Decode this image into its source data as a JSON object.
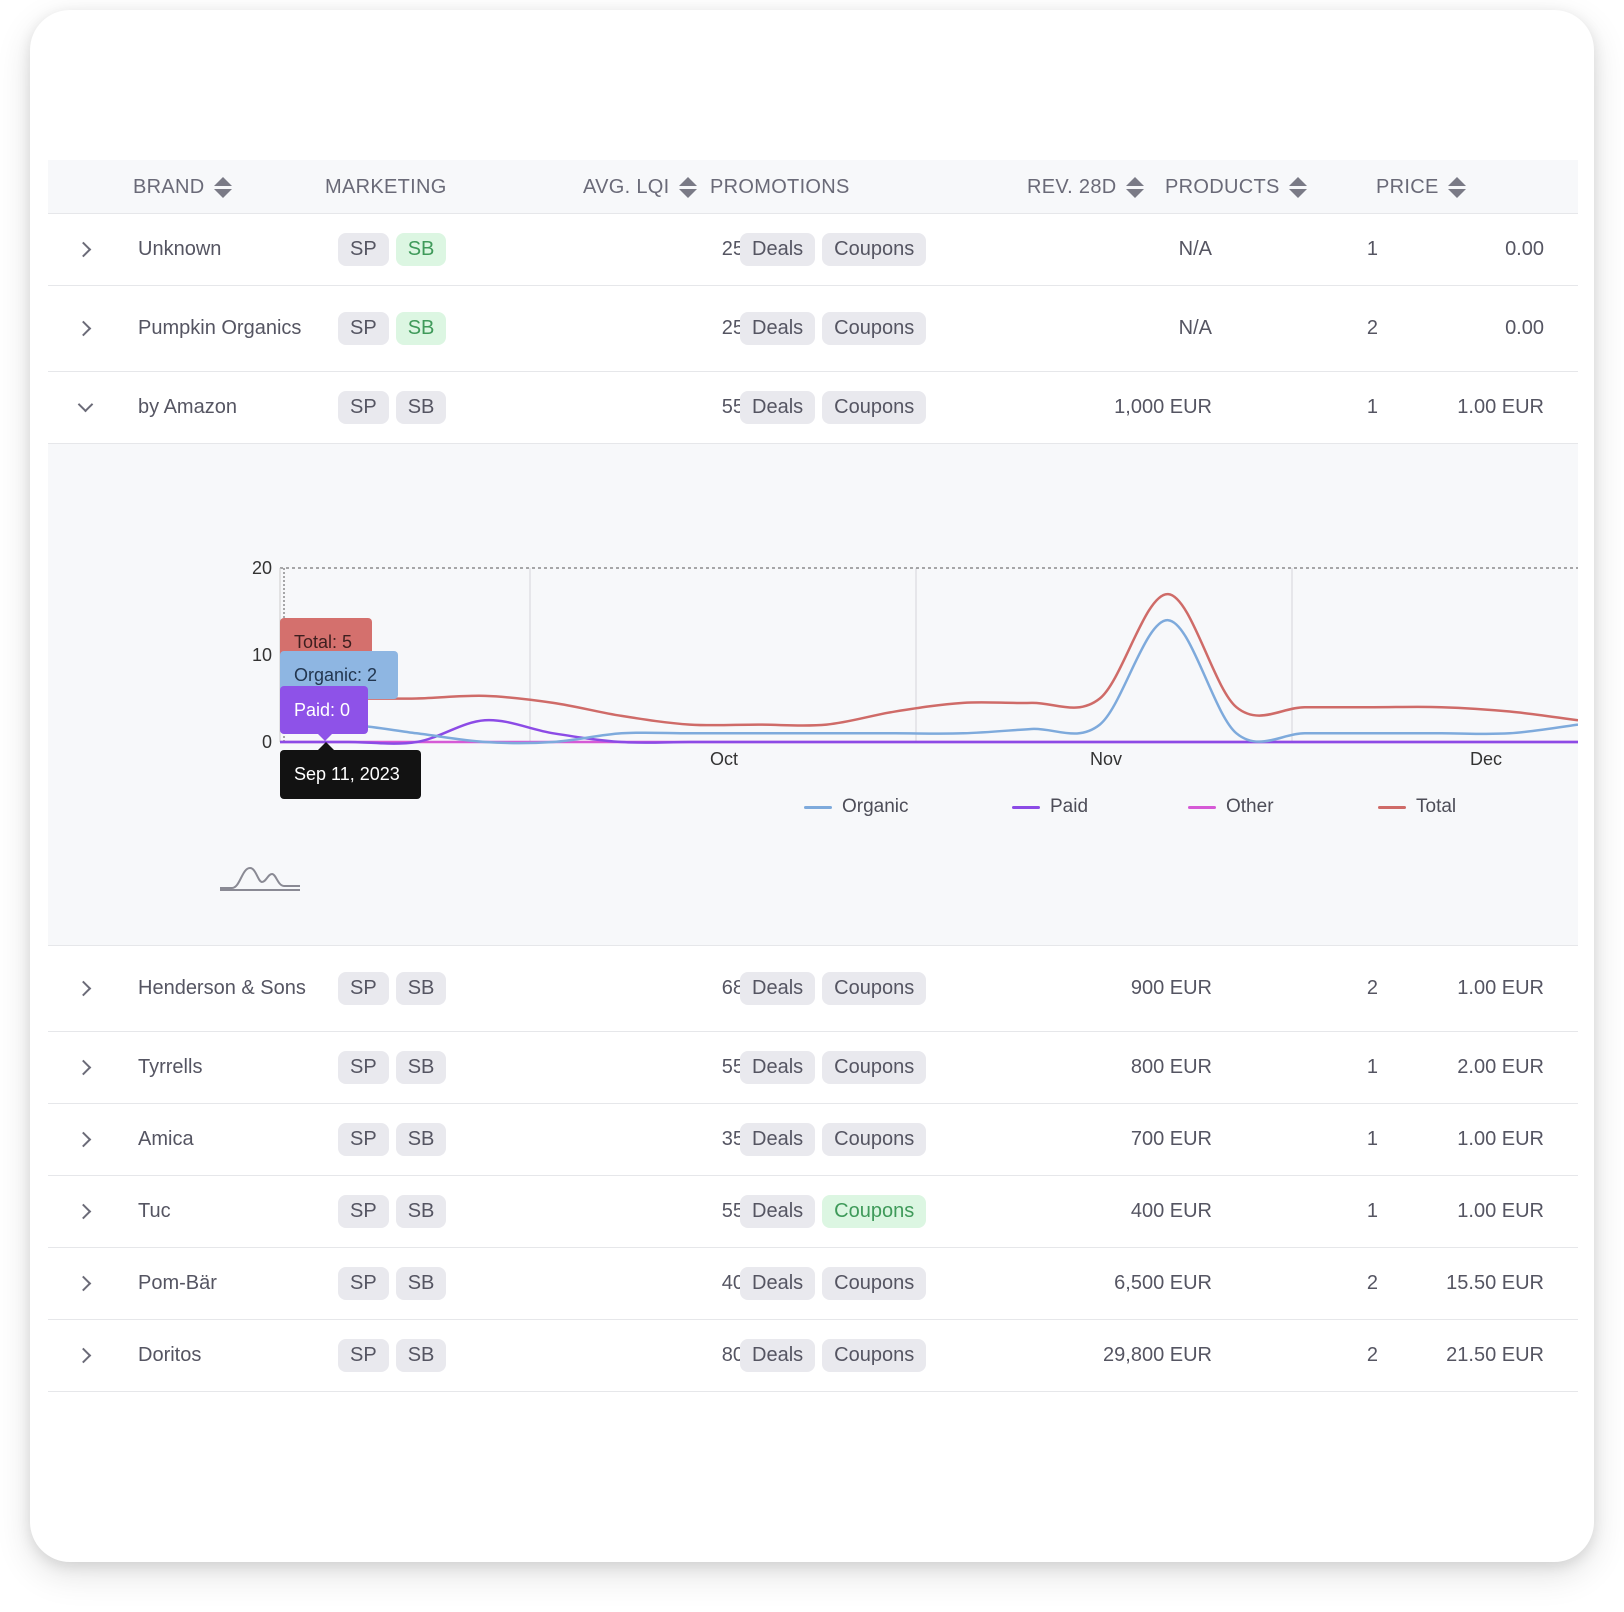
{
  "columns": {
    "brand": "BRAND",
    "marketing": "MARKETING",
    "avg_lqi": "AVG. LQI",
    "promotions": "PROMOTIONS",
    "rev_28d": "REV. 28D",
    "products": "PRODUCTS",
    "price": "PRICE"
  },
  "tag_labels": {
    "sp": "SP",
    "sb": "SB",
    "deals": "Deals",
    "coupons": "Coupons"
  },
  "rows_before": [
    {
      "brand": "Unknown",
      "sb_active": true,
      "coupons_active": false,
      "lqi": "25",
      "rev": "N/A",
      "products": "1",
      "price": "0.00"
    },
    {
      "brand": "Pumpkin Organics",
      "sb_active": true,
      "coupons_active": false,
      "lqi": "25",
      "rev": "N/A",
      "products": "2",
      "price": "0.00"
    },
    {
      "brand": "by Amazon",
      "sb_active": false,
      "coupons_active": false,
      "lqi": "55",
      "rev": "1,000 EUR",
      "products": "1",
      "price": "1.00 EUR",
      "expanded": true
    }
  ],
  "rows_after": [
    {
      "brand": "Henderson & Sons",
      "sb_active": false,
      "coupons_active": false,
      "lqi": "68",
      "rev": "900 EUR",
      "products": "2",
      "price": "1.00 EUR"
    },
    {
      "brand": "Tyrrells",
      "sb_active": false,
      "coupons_active": false,
      "lqi": "55",
      "rev": "800 EUR",
      "products": "1",
      "price": "2.00 EUR"
    },
    {
      "brand": "Amica",
      "sb_active": false,
      "coupons_active": false,
      "lqi": "35",
      "rev": "700 EUR",
      "products": "1",
      "price": "1.00 EUR"
    },
    {
      "brand": "Tuc",
      "sb_active": false,
      "coupons_active": true,
      "lqi": "55",
      "rev": "400 EUR",
      "products": "1",
      "price": "1.00 EUR"
    },
    {
      "brand": "Pom-Bär",
      "sb_active": false,
      "coupons_active": false,
      "lqi": "40",
      "rev": "6,500 EUR",
      "products": "2",
      "price": "15.50 EUR"
    },
    {
      "brand": "Doritos",
      "sb_active": false,
      "coupons_active": false,
      "lqi": "80",
      "rev": "29,800 EUR",
      "products": "2",
      "price": "21.50 EUR"
    }
  ],
  "tooltip": {
    "total": "Total: 5",
    "organic": "Organic: 2",
    "paid": "Paid: 0",
    "date": "Sep 11, 2023"
  },
  "colors": {
    "organic": "#7eaadc",
    "paid": "#8c4be6",
    "other": "#d65ad6",
    "total": "#cf6b68",
    "tag_active_bg": "#dcf6e2",
    "tag_active_text": "#3f9a5a"
  },
  "chart_data": {
    "type": "line",
    "x_ticks": [
      "Sep",
      "Oct",
      "Nov",
      "Dec"
    ],
    "ylim": [
      0,
      20
    ],
    "y_ticks": [
      0,
      10,
      20
    ],
    "x": [
      "Sep 11",
      "Sep 14",
      "Sep 17",
      "Sep 20",
      "Sep 23",
      "Sep 26",
      "Oct 3",
      "Oct 10",
      "Oct 17",
      "Oct 24",
      "Oct 31",
      "Nov 7",
      "Nov 14",
      "Nov 21",
      "Nov 28",
      "Dec 5",
      "Dec 12",
      "Dec 19",
      "Dec 26",
      "Dec 31"
    ],
    "series": [
      {
        "name": "Organic",
        "color_key": "organic",
        "values": [
          2,
          2,
          1,
          0,
          0,
          1,
          1,
          1,
          1,
          1,
          1,
          1.5,
          2,
          14,
          1,
          1,
          1,
          1,
          1,
          2
        ]
      },
      {
        "name": "Paid",
        "color_key": "paid",
        "values": [
          0,
          0,
          0,
          2.5,
          1,
          0,
          0,
          0,
          0,
          0,
          0,
          0,
          0,
          0,
          0,
          0,
          0,
          0,
          0,
          0
        ]
      },
      {
        "name": "Other",
        "color_key": "other",
        "values": [
          0,
          0,
          0,
          0,
          0,
          0,
          0,
          0,
          0,
          0,
          0,
          0,
          0,
          0,
          0,
          0,
          0,
          0,
          0,
          0
        ]
      },
      {
        "name": "Total",
        "color_key": "total",
        "values": [
          5,
          5,
          5,
          5.3,
          4.5,
          3,
          2,
          2,
          2,
          3.5,
          4.5,
          4.5,
          5,
          17,
          4,
          4,
          4,
          4,
          3.5,
          2.5
        ]
      }
    ],
    "legend": [
      "Organic",
      "Paid",
      "Other",
      "Total"
    ],
    "grid": true,
    "legend_position": "bottom"
  }
}
